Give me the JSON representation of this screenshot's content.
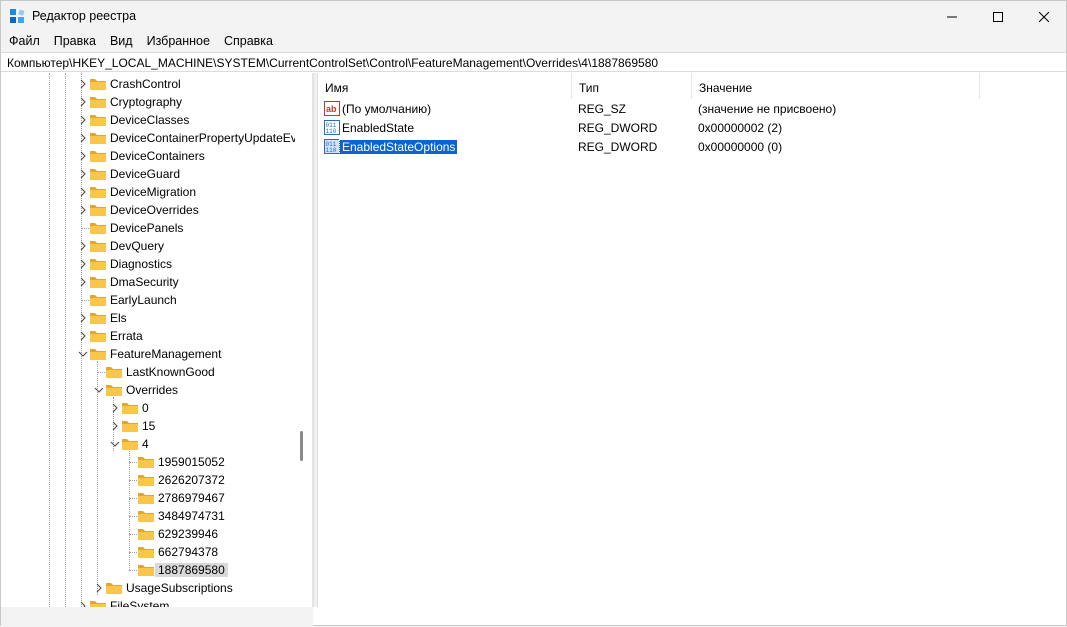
{
  "window": {
    "title": "Редактор реестра"
  },
  "menu": [
    "Файл",
    "Правка",
    "Вид",
    "Избранное",
    "Справка"
  ],
  "address": "Компьютер\\HKEY_LOCAL_MACHINE\\SYSTEM\\CurrentControlSet\\Control\\FeatureManagement\\Overrides\\4\\1887869580",
  "tree": [
    {
      "label": "CrashControl",
      "level": 0,
      "expander": "collapsed"
    },
    {
      "label": "Cryptography",
      "level": 0,
      "expander": "collapsed"
    },
    {
      "label": "DeviceClasses",
      "level": 0,
      "expander": "collapsed"
    },
    {
      "label": "DeviceContainerPropertyUpdateEvents",
      "level": 0,
      "expander": "collapsed"
    },
    {
      "label": "DeviceContainers",
      "level": 0,
      "expander": "collapsed"
    },
    {
      "label": "DeviceGuard",
      "level": 0,
      "expander": "collapsed"
    },
    {
      "label": "DeviceMigration",
      "level": 0,
      "expander": "collapsed"
    },
    {
      "label": "DeviceOverrides",
      "level": 0,
      "expander": "collapsed"
    },
    {
      "label": "DevicePanels",
      "level": 0,
      "expander": "none"
    },
    {
      "label": "DevQuery",
      "level": 0,
      "expander": "collapsed"
    },
    {
      "label": "Diagnostics",
      "level": 0,
      "expander": "collapsed"
    },
    {
      "label": "DmaSecurity",
      "level": 0,
      "expander": "collapsed"
    },
    {
      "label": "EarlyLaunch",
      "level": 0,
      "expander": "none"
    },
    {
      "label": "Els",
      "level": 0,
      "expander": "collapsed"
    },
    {
      "label": "Errata",
      "level": 0,
      "expander": "collapsed"
    },
    {
      "label": "FeatureManagement",
      "level": 0,
      "expander": "expanded"
    },
    {
      "label": "LastKnownGood",
      "level": 1,
      "expander": "none"
    },
    {
      "label": "Overrides",
      "level": 1,
      "expander": "expanded"
    },
    {
      "label": "0",
      "level": 2,
      "expander": "collapsed"
    },
    {
      "label": "15",
      "level": 2,
      "expander": "collapsed"
    },
    {
      "label": "4",
      "level": 2,
      "expander": "expanded"
    },
    {
      "label": "1959015052",
      "level": 3,
      "expander": "none"
    },
    {
      "label": "2626207372",
      "level": 3,
      "expander": "none"
    },
    {
      "label": "2786979467",
      "level": 3,
      "expander": "none"
    },
    {
      "label": "3484974731",
      "level": 3,
      "expander": "none"
    },
    {
      "label": "629239946",
      "level": 3,
      "expander": "none"
    },
    {
      "label": "662794378",
      "level": 3,
      "expander": "none"
    },
    {
      "label": "1887869580",
      "level": 3,
      "expander": "none",
      "selected": true
    },
    {
      "label": "UsageSubscriptions",
      "level": 1,
      "expander": "collapsed"
    },
    {
      "label": "FileSystem",
      "level": 0,
      "expander": "collapsed"
    }
  ],
  "columns": {
    "name": "Имя",
    "type": "Тип",
    "value": "Значение"
  },
  "values": [
    {
      "icon": "string-value-icon",
      "name": "(По умолчанию)",
      "type": "REG_SZ",
      "data": "(значение не присвоено)"
    },
    {
      "icon": "dword-value-icon",
      "name": "EnabledState",
      "type": "REG_DWORD",
      "data": "0x00000002 (2)"
    },
    {
      "icon": "dword-value-icon",
      "name": "EnabledStateOptions",
      "type": "REG_DWORD",
      "data": "0x00000000 (0)",
      "selected": true
    }
  ],
  "colors": {
    "selection": "#0a64d2",
    "folder": "#f8c74a",
    "tree_selection": "#d9d9d9"
  }
}
